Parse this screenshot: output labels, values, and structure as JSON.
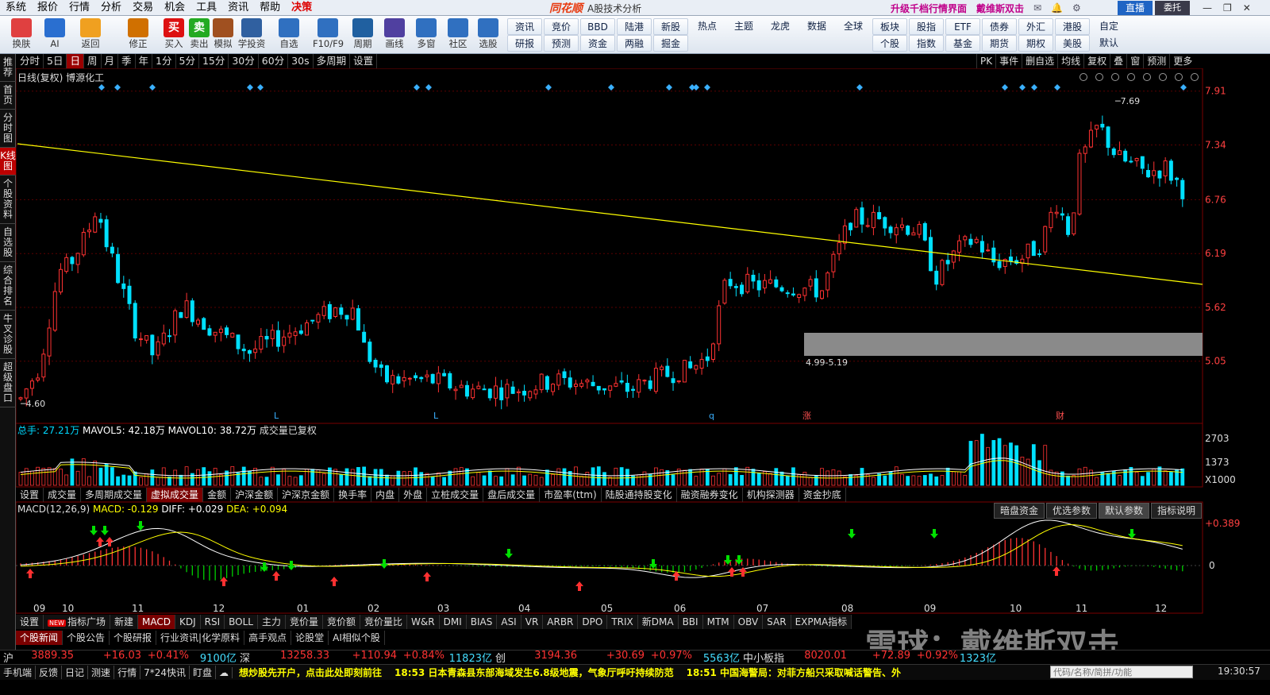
{
  "menu": [
    "系统",
    "报价",
    "行情",
    "分析",
    "交易",
    "机会",
    "工具",
    "资讯",
    "帮助",
    "决策"
  ],
  "brand": {
    "logo": "同花顺",
    "subtitle": "A股技术分析"
  },
  "topright": {
    "promo": "升级千档行情界面",
    "user": "戴维斯双击",
    "live": "直播",
    "trade": "委托"
  },
  "toolbar": {
    "icons": [
      [
        "换肤",
        ""
      ],
      [
        "AI",
        ""
      ],
      [
        "返回",
        ""
      ],
      [
        "修正",
        ""
      ],
      [
        "买入",
        "买"
      ],
      [
        "卖出",
        "卖"
      ],
      [
        "模拟",
        ""
      ],
      [
        "学投资",
        ""
      ],
      [
        "自选",
        ""
      ],
      [
        "F10/F9",
        ""
      ],
      [
        "周期",
        ""
      ],
      [
        "画线",
        ""
      ],
      [
        "多窗",
        ""
      ],
      [
        "社区",
        ""
      ],
      [
        "选股",
        ""
      ]
    ],
    "grid": [
      "资讯",
      "竞价",
      "BBD",
      "陆港",
      "新股",
      "热点",
      "主题",
      "龙虎",
      "数据",
      "全球",
      "板块",
      "股指",
      "ETF",
      "债券",
      "外汇",
      "港股",
      "自定",
      "默认",
      "研报",
      "预测",
      "资金",
      "两融",
      "掘金",
      "个股",
      "指数",
      "基金",
      "期货",
      "期权",
      "美股"
    ]
  },
  "leftnav": [
    "推荐",
    "首页",
    "分时图",
    "K线图",
    "个股资料",
    "自选股",
    "综合排名",
    "牛叉诊股",
    "超级盘口"
  ],
  "periods": [
    "分时",
    "5日",
    "日",
    "周",
    "月",
    "季",
    "年",
    "1分",
    "5分",
    "15分",
    "30分",
    "60分",
    "30s",
    "多周期",
    "设置"
  ],
  "periods_right": [
    "PK",
    "事件",
    "删自选",
    "均线",
    "复权",
    "叠",
    "窗",
    "预测",
    "更多"
  ],
  "chart": {
    "title": "日线(复权) 博源化工",
    "price_ticks": [
      "7.91",
      "7.34",
      "6.76",
      "6.19",
      "5.62",
      "5.05"
    ],
    "high_label": "7.69",
    "low_label": "4.60",
    "gap_label": "4.99-5.19",
    "event_marks": [
      "L",
      "L",
      "q",
      "涨",
      "财"
    ],
    "month_labels": [
      "09",
      "10",
      "11",
      "12",
      "01",
      "02",
      "03",
      "04",
      "05",
      "06",
      "07",
      "08",
      "09",
      "10",
      "11",
      "12"
    ]
  },
  "volume": {
    "label": "总手: 27.21万",
    "mavol5": "MAVOL5: 42.18万",
    "mavol10": "MAVOL10: 38.72万",
    "note": "成交量已复权",
    "ticks": [
      "2703",
      "1373",
      "X1000"
    ]
  },
  "tabs1": [
    "设置",
    "成交量",
    "多周期成交量",
    "虚拟成交量",
    "金额",
    "沪深金额",
    "沪深京金额",
    "换手率",
    "内盘",
    "外盘",
    "立桩成交量",
    "盘后成交量",
    "市盈率(ttm)",
    "陆股通持股变化",
    "融资融券变化",
    "机构探测器",
    "资金抄底"
  ],
  "macd": {
    "name": "MACD(12,26,9)",
    "macd": "MACD: -0.129",
    "diff": "DIFF: +0.029",
    "dea": "DEA: +0.094",
    "ticks": [
      "+0.389",
      "0"
    ],
    "buttons": [
      "暗盘资金",
      "优选参数",
      "默认参数",
      "指标说明"
    ]
  },
  "tabs2": [
    "设置",
    "指标广场",
    "新建",
    "MACD",
    "KDJ",
    "RSI",
    "BOLL",
    "主力",
    "竞价量",
    "竞价额",
    "竞价量比",
    "W&R",
    "DMI",
    "BIAS",
    "ASI",
    "VR",
    "ARBR",
    "DPO",
    "TRIX",
    "新DMA",
    "BBI",
    "MTM",
    "OBV",
    "SAR",
    "EXPMA指标"
  ],
  "newstabs": [
    "个股新闻",
    "个股公告",
    "个股研报",
    "行业资讯|化学原料",
    "高手观点",
    "论股堂",
    "AI相似个股"
  ],
  "watermark": "雪球：戴维斯双击",
  "indexbar": [
    {
      "name": "沪",
      "price": "3889.35",
      "chg": "+16.03",
      "pct": "+0.41%",
      "amt": "9100亿"
    },
    {
      "name": "深",
      "price": "13258.33",
      "chg": "+110.94",
      "pct": "+0.84%",
      "amt": "11823亿"
    },
    {
      "name": "创",
      "price": "3194.36",
      "chg": "+30.69",
      "pct": "+0.97%",
      "amt": "5563亿"
    },
    {
      "name": "中小板指",
      "price": "8020.01",
      "chg": "+72.89",
      "pct": "+0.92%",
      "amt": "1323亿"
    }
  ],
  "statusbar": {
    "items": [
      "手机端",
      "反馈",
      "日记",
      "测速",
      "行情",
      "7*24快讯",
      "盯盘"
    ],
    "news1": "想炒股先开户，点击此处即刻前往",
    "news2": "18:53 日本青森县东部海域发生6.8级地震，气象厅呼吁持续防范",
    "news3": "18:51 中国海警局：对菲方船只采取喊话警告、外",
    "search_placeholder": "代码/名称/简拼/功能",
    "clock": "19:30:57"
  },
  "colors": {
    "up": "#ff3232",
    "down": "#00e0ff",
    "trend": "#ffff00"
  }
}
